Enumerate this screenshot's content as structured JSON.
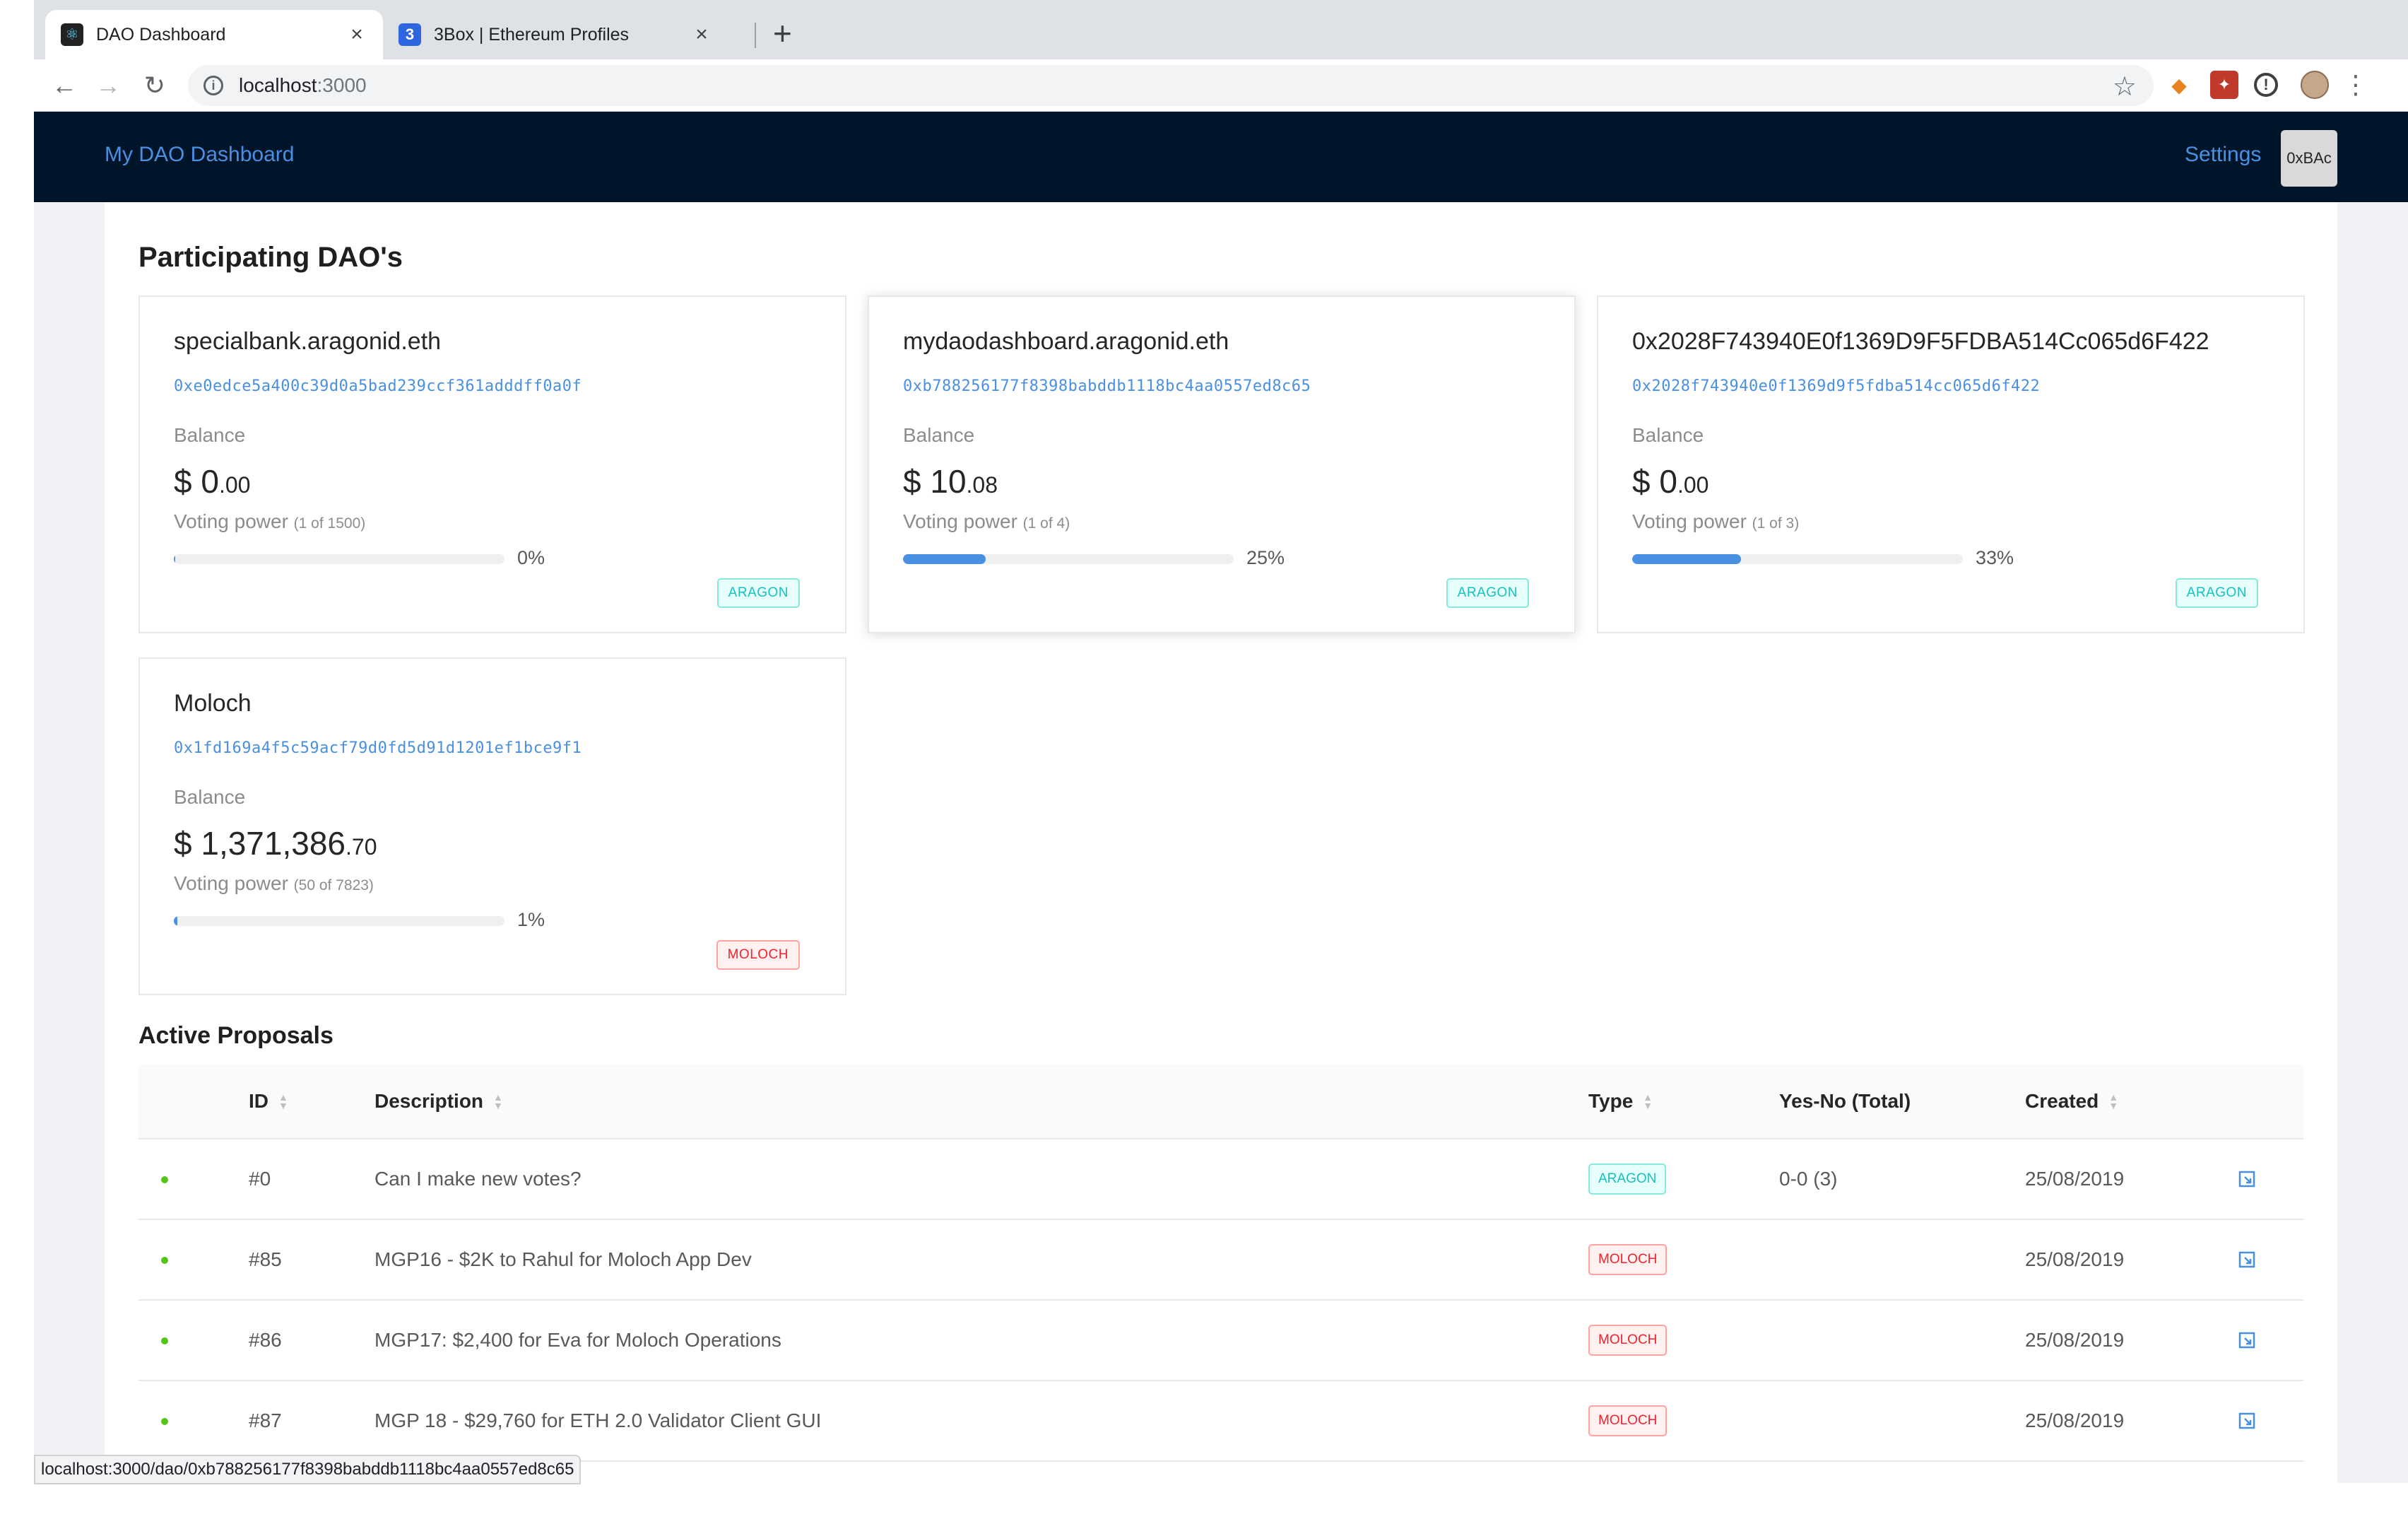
{
  "browser": {
    "tabs": [
      {
        "title": "DAO Dashboard",
        "favicon": "react-icon",
        "active": true
      },
      {
        "title": "3Box | Ethereum Profiles",
        "favicon": "3",
        "active": false
      }
    ],
    "url_host": "localhost",
    "url_port": ":3000",
    "status_url": "localhost:3000/dao/0xb788256177f8398babddb1118bc4aa0557ed8c65"
  },
  "header": {
    "brand": "My DAO Dashboard",
    "settings": "Settings",
    "account": "0xBAc"
  },
  "daos_section": {
    "title": "Participating DAO's"
  },
  "daos": [
    {
      "name": "specialbank.aragonid.eth",
      "address": "0xe0edce5a400c39d0a5bad239ccf361adddff0a0f",
      "balance_label": "Balance",
      "balance_whole": "$ 0",
      "balance_cents": ".00",
      "voting_label": "Voting power",
      "voting_detail": "(1 of 1500)",
      "percent_label": "0%",
      "percent": 0,
      "tag": "ARAGON"
    },
    {
      "name": "mydaodashboard.aragonid.eth",
      "address": "0xb788256177f8398babddb1118bc4aa0557ed8c65",
      "balance_label": "Balance",
      "balance_whole": "$ 10",
      "balance_cents": ".08",
      "voting_label": "Voting power",
      "voting_detail": "(1 of 4)",
      "percent_label": "25%",
      "percent": 25,
      "tag": "ARAGON"
    },
    {
      "name": "0x2028F743940E0f1369D9F5FDBA514Cc065d6F422",
      "address": "0x2028f743940e0f1369d9f5fdba514cc065d6f422",
      "balance_label": "Balance",
      "balance_whole": "$ 0",
      "balance_cents": ".00",
      "voting_label": "Voting power",
      "voting_detail": "(1 of 3)",
      "percent_label": "33%",
      "percent": 33,
      "tag": "ARAGON"
    },
    {
      "name": "Moloch",
      "address": "0x1fd169a4f5c59acf79d0fd5d91d1201ef1bce9f1",
      "balance_label": "Balance",
      "balance_whole": "$ 1,371,386",
      "balance_cents": ".70",
      "voting_label": "Voting power",
      "voting_detail": "(50 of 7823)",
      "percent_label": "1%",
      "percent": 1,
      "tag": "MOLOCH"
    }
  ],
  "proposals_section": {
    "title": "Active Proposals"
  },
  "proposals_table": {
    "columns": {
      "id": "ID",
      "description": "Description",
      "type": "Type",
      "votes": "Yes-No (Total)",
      "created": "Created"
    },
    "rows": [
      {
        "id": "#0",
        "description": "Can I make new votes?",
        "type": "ARAGON",
        "votes": "0-0 (3)",
        "created": "25/08/2019"
      },
      {
        "id": "#85",
        "description": "MGP16 - $2K to Rahul for Moloch App Dev",
        "type": "MOLOCH",
        "votes": "",
        "created": "25/08/2019"
      },
      {
        "id": "#86",
        "description": "MGP17: $2,400 for Eva for Moloch Operations",
        "type": "MOLOCH",
        "votes": "",
        "created": "25/08/2019"
      },
      {
        "id": "#87",
        "description": "MGP 18 - $29,760 for ETH 2.0 Validator Client GUI",
        "type": "MOLOCH",
        "votes": "",
        "created": "25/08/2019"
      }
    ]
  },
  "colors": {
    "header_bg": "#001529",
    "link": "#4a90e2",
    "aragon": "#13c2c2",
    "moloch": "#f5222d",
    "active_dot": "#52c41a"
  }
}
